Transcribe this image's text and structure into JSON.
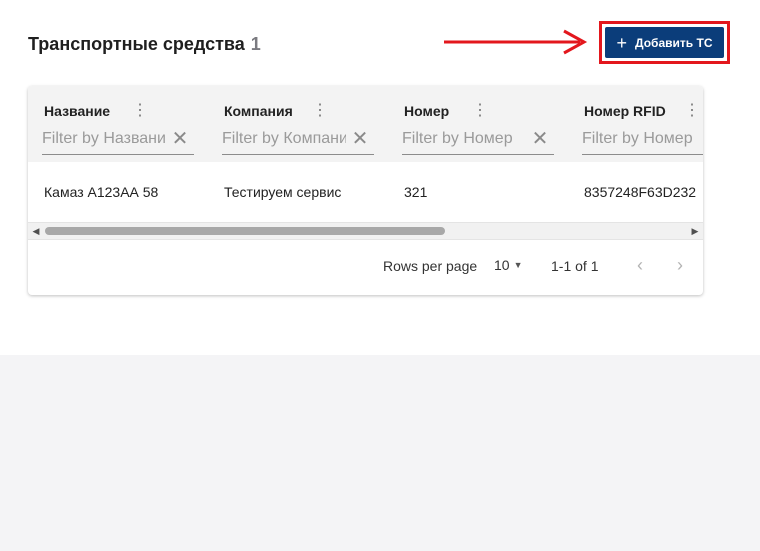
{
  "page": {
    "title": "Транспортные средства",
    "count": "1"
  },
  "actions": {
    "add_label": "Добавить ТС",
    "add_icon": "plus-icon",
    "accent_color": "#0b3d7a",
    "highlight_color": "#e3171d"
  },
  "grid": {
    "columns": [
      {
        "title": "Название",
        "filter_placeholder": "Filter by Названию"
      },
      {
        "title": "Компания",
        "filter_placeholder": "Filter by Компании"
      },
      {
        "title": "Номер",
        "filter_placeholder": "Filter by Номер"
      },
      {
        "title": "Номер RFID",
        "filter_placeholder": "Filter by Номер RFID"
      }
    ],
    "rows": [
      [
        "Камаз А123АА 58",
        "Тестируем сервис",
        "321",
        "8357248F63D232"
      ]
    ],
    "column_menu_icon": "more-vert-icon",
    "clear_icon": "close-icon"
  },
  "pagination": {
    "rows_per_page_label": "Rows per page",
    "rows_per_page_value": "10",
    "range": "1-1 of 1"
  }
}
